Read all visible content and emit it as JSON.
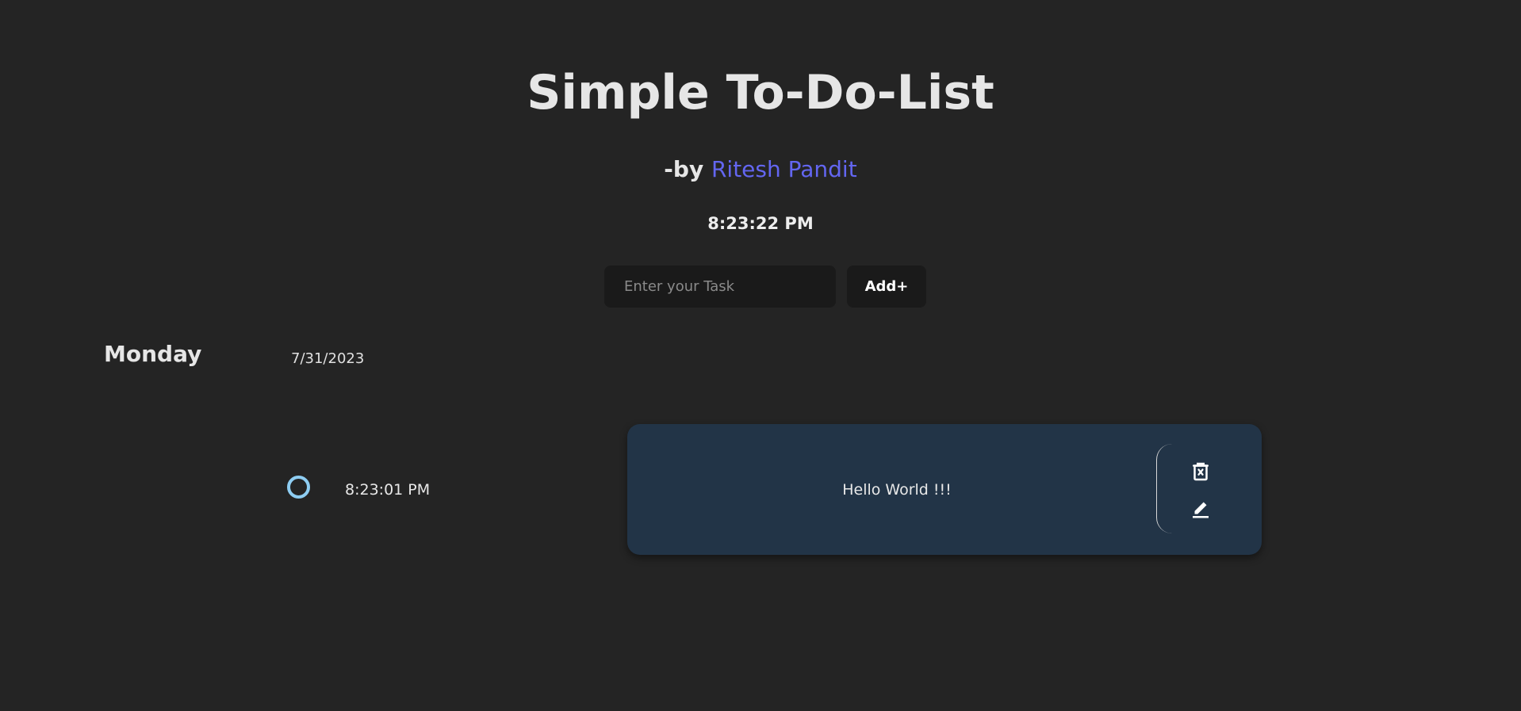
{
  "header": {
    "title": "Simple To-Do-List",
    "byline_prefix": "-by",
    "author": "Ritesh Pandit",
    "clock": "8:23:22 PM"
  },
  "form": {
    "placeholder": "Enter your Task",
    "value": "",
    "add_label": "Add+"
  },
  "day_header": {
    "day": "Monday",
    "date": "7/31/2023"
  },
  "tasks": [
    {
      "time": "8:23:01 PM",
      "text": "Hello World !!!",
      "completed": false
    }
  ],
  "colors": {
    "background": "#242424",
    "accent_author": "#6366f1",
    "card": "#223447",
    "status_ring": "#8ecdf2"
  },
  "icons": {
    "delete": "trash-x-icon",
    "edit": "pencil-icon"
  }
}
